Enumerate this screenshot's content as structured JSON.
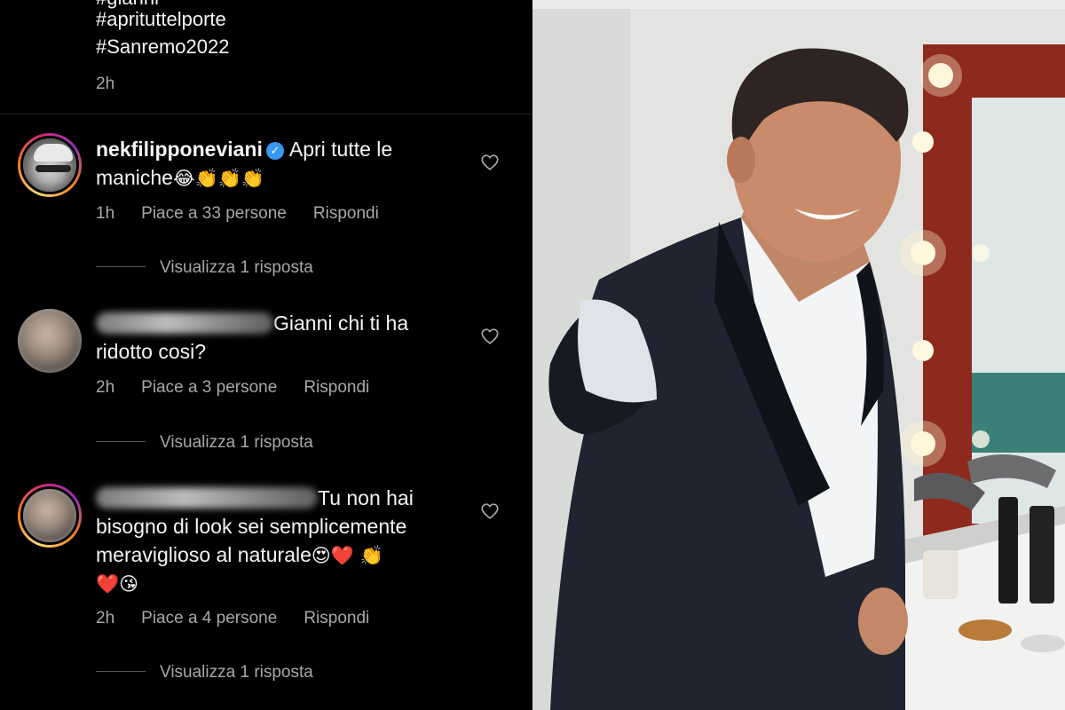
{
  "caption": {
    "cut_line": "#gianni",
    "line1": "#aprituttelporte",
    "line2": "#Sanremo2022",
    "time": "2h"
  },
  "comments": [
    {
      "username": "nekfilipponeviani",
      "verified": true,
      "line1": "Apri tutte le",
      "line2_text": "maniche",
      "line2_emoji": "😂👏👏👏",
      "time": "1h",
      "likes": "Piace a 33 persone",
      "reply": "Rispondi",
      "view_replies": "Visualizza 1 risposta"
    },
    {
      "line1": "Gianni chi ti ha",
      "line2": "ridotto cosi?",
      "time": "2h",
      "likes": "Piace a 3 persone",
      "reply": "Rispondi",
      "view_replies": "Visualizza 1 risposta"
    },
    {
      "line1": "Tu non hai",
      "line2": "bisogno di look sei semplicemente",
      "line3_text": "meraviglioso  al naturale",
      "line3_emoji": "😍❤️ 👏",
      "line4_emoji": "❤️😘",
      "time": "2h",
      "likes": "Piace a 4 persone",
      "reply": "Rispondi",
      "view_replies": "Visualizza 1 risposta"
    }
  ],
  "icons": {
    "heart": "heart-outline-icon",
    "verified": "verified-badge-icon"
  },
  "colors": {
    "background": "#000000",
    "text": "#f5f5f5",
    "secondary_text": "#a8a8a8",
    "verified": "#3897f0"
  }
}
